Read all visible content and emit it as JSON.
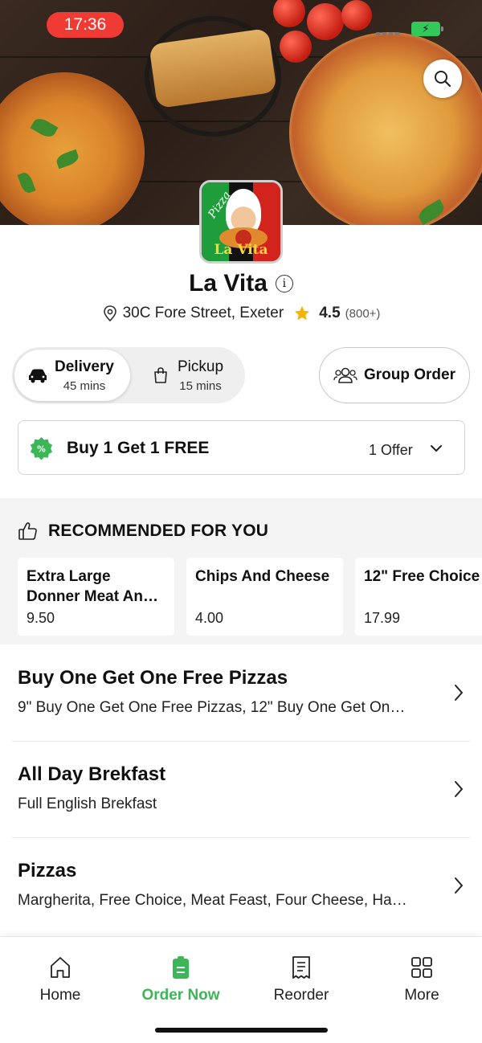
{
  "status_bar": {
    "time": "17:36"
  },
  "restaurant": {
    "name": "La Vita",
    "logo_text": "La Vita",
    "logo_script": "Pizza",
    "address": "30C Fore Street, Exeter",
    "rating": "4.5",
    "reviews": "(800+)"
  },
  "modes": {
    "delivery": {
      "label": "Delivery",
      "time": "45 mins",
      "selected": true
    },
    "pickup": {
      "label": "Pickup",
      "time": "15 mins",
      "selected": false
    }
  },
  "group_order": {
    "label": "Group Order"
  },
  "offer": {
    "title": "Buy 1 Get 1 FREE",
    "count": "1 Offer"
  },
  "recommended": {
    "heading": "RECOMMENDED FOR YOU",
    "items": [
      {
        "name": "Extra Large Donner Meat An…",
        "price": "9.50"
      },
      {
        "name": "Chips And Cheese",
        "price": "4.00"
      },
      {
        "name": "12\" Free Choice",
        "price": "17.99"
      }
    ]
  },
  "categories": [
    {
      "title": "Buy One Get One Free Pizzas",
      "desc": "9\" Buy One Get One Free Pizzas, 12\" Buy One Get On…"
    },
    {
      "title": "All Day Brekfast",
      "desc": "Full English Brekfast"
    },
    {
      "title": "Pizzas",
      "desc": "Margherita, Free Choice, Meat Feast, Four Cheese, Ha…"
    }
  ],
  "nav": {
    "items": [
      {
        "label": "Home",
        "icon": "home-icon"
      },
      {
        "label": "Order Now",
        "icon": "order-icon",
        "active": true
      },
      {
        "label": "Reorder",
        "icon": "receipt-icon"
      },
      {
        "label": "More",
        "icon": "grid-icon"
      }
    ]
  },
  "colors": {
    "accent": "#3db657",
    "time_pill": "#ef3b34",
    "star": "#f5b400"
  }
}
